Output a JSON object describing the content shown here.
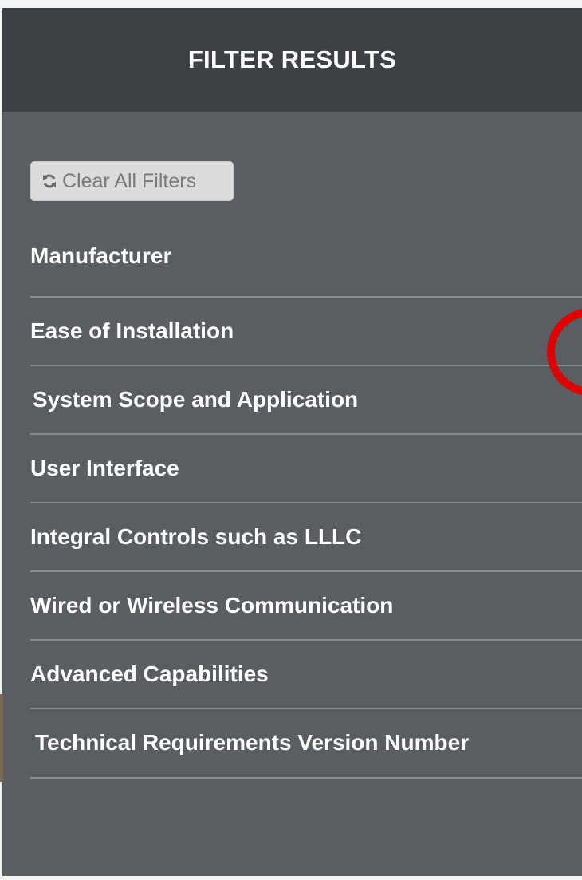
{
  "panel": {
    "title": "FILTER RESULTS",
    "clear_button_label": "Clear All Filters",
    "clear_button_icon": "refresh-icon"
  },
  "filters": [
    {
      "label": "Manufacturer"
    },
    {
      "label": "Ease of Installation"
    },
    {
      "label": "System Scope and Application"
    },
    {
      "label": "User Interface"
    },
    {
      "label": "Integral Controls such as LLLC"
    },
    {
      "label": "Wired or Wireless Communication"
    },
    {
      "label": "Advanced Capabilities"
    },
    {
      "label": "Technical Requirements Version Number"
    }
  ],
  "colors": {
    "panel_bg": "#5a5d61",
    "header_bg": "#3d4045",
    "annotation_circle": "#e00000"
  }
}
